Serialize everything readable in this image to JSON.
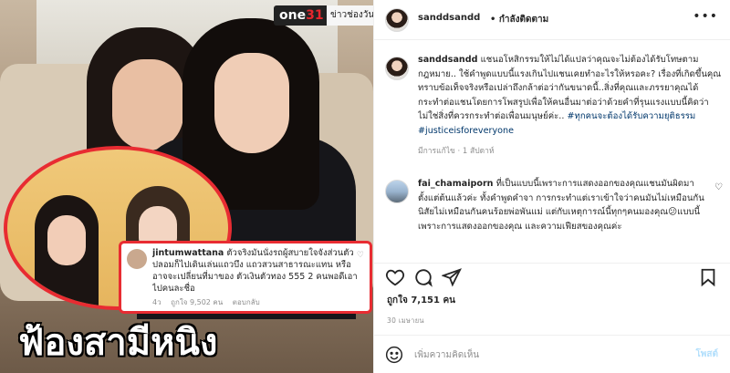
{
  "photo": {
    "channel_logo_text": "one",
    "channel_logo_number": "31",
    "news_tag": "ข่าวช่องวัน",
    "inset_comment": {
      "username": "jintumwattana",
      "text": "ตัวจริงมันนั่งรถผู้สบายใจจังส่วนตัวปลอมก็ไปเดินเล่นแถวบึง แถวสวนสาธารณะแทน หรืออาจจะเปลี่ยนที่มาของ ตัวเงินตัวทอง 555 2 คนพอดีเอาไปคนละชื่อ",
      "time": "4ว",
      "likes": "ถูกใจ 9,502 คน",
      "reply": "ตอบกลับ"
    },
    "headline": "ฟ้องสามีหนิง"
  },
  "header": {
    "username": "sanddsandd",
    "follow_status": "• กำลังติดตาม",
    "more_icon": "more-horizontal-icon"
  },
  "caption": {
    "username": "sanddsandd",
    "text": "แชนอโหสิกรรมให้ไม่ได้แปลว่าคุณจะไม่ต้องได้รับโทษตามกฎหมาย.. ใช้คำพูดแบบนี้แรงเกินไปแชนเคยทำอะไรให้หรอคะ? เรื่องที่เกิดขึ้นคุณทราบข้อเท็จจริงหรือเปล่าถึงกล้าต่อว่ากันขนาดนี้..สิ่งที่คุณและภรรยาคุณได้กระทำต่อแชนโดยการโพสรูปเพื่อให้คนอื่นมาต่อว่าด้วยคำที่รุนแรงแบบนี้คิดว่าไม่ใช่สิ่งที่ควรกระทำต่อเพื่อนมนุษย์ค่ะ..",
    "hashtags": "#ทุกคนจะต้องได้รับความยุติธรรม #justiceisforeveryone",
    "meta": "มีการแก้ไข · 1 สัปดาห์"
  },
  "comment": {
    "username": "fai_chamaiporn",
    "text": "ที่เป็นแบบนี้เพราะการแสดงออกของคุณแชนมันผิดมาตั้งแต่ต้นแล้วค่ะ ทั้งคำพูดคำจา การกระทำแต่เราเข้าใจว่าคนมันไม่เหมือนกัน นิสัยไม่เหมือนกันคนร้อยพ่อพันแม่ แต่กับเหตุการณ์นี้ทุกๆคนมองคุณ😕แบบนี้เพราะการแสดงออกของคุณ และความเฟียสของคุณค่ะ"
  },
  "actions": {
    "like_icon": "heart-icon",
    "comment_icon": "comment-bubble-icon",
    "share_icon": "paper-plane-icon",
    "save_icon": "bookmark-icon"
  },
  "likes": "ถูกใจ 7,151 คน",
  "date": "30 เมษายน",
  "add_comment": {
    "placeholder": "เพิ่มความคิดเห็น",
    "post_label": "โพสต์",
    "emoji_icon": "smiley-icon"
  }
}
